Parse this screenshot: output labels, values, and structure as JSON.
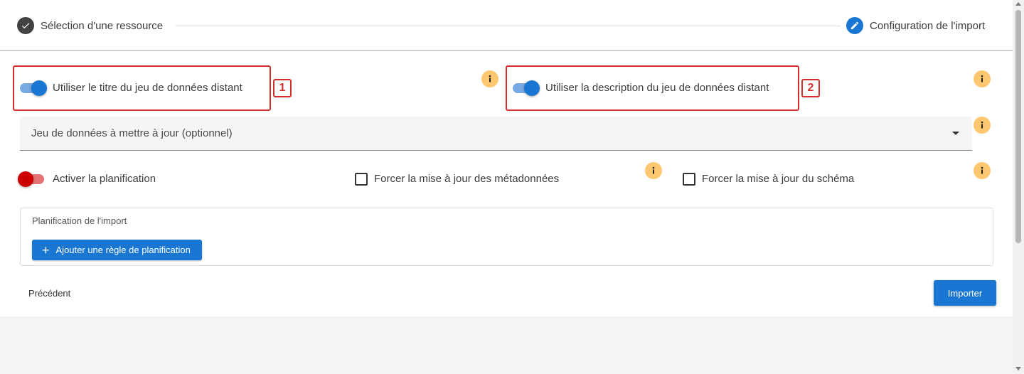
{
  "stepper": {
    "step1": {
      "label": "Sélection d'une ressource",
      "state": "completed",
      "icon": "check-icon"
    },
    "step2": {
      "label": "Configuration de l'import",
      "state": "active",
      "icon": "pencil-icon"
    }
  },
  "form": {
    "toggle_title": {
      "label": "Utiliser le titre du jeu de données distant",
      "checked": true,
      "annotation": "1"
    },
    "toggle_description": {
      "label": "Utiliser la description du jeu de données distant",
      "checked": true,
      "annotation": "2"
    },
    "dataset_select": {
      "placeholder": "Jeu de données à mettre à jour (optionnel)"
    },
    "toggle_schedule": {
      "label": "Activer la planification",
      "checked": false
    },
    "checkbox_metadata": {
      "label": "Forcer la mise à jour des métadonnées",
      "checked": false
    },
    "checkbox_schema": {
      "label": "Forcer la mise à jour du schéma",
      "checked": false
    },
    "info_icon_glyph": "i"
  },
  "schedule": {
    "title": "Planification de l'import",
    "add_rule_label": "Ajouter une règle de planification"
  },
  "actions": {
    "previous_label": "Précédent",
    "import_label": "Importer"
  },
  "colors": {
    "primary": "#1976d2",
    "error_red": "#d32f2f",
    "info_orange": "#ffc870",
    "toggle_off": "#cc0000"
  }
}
